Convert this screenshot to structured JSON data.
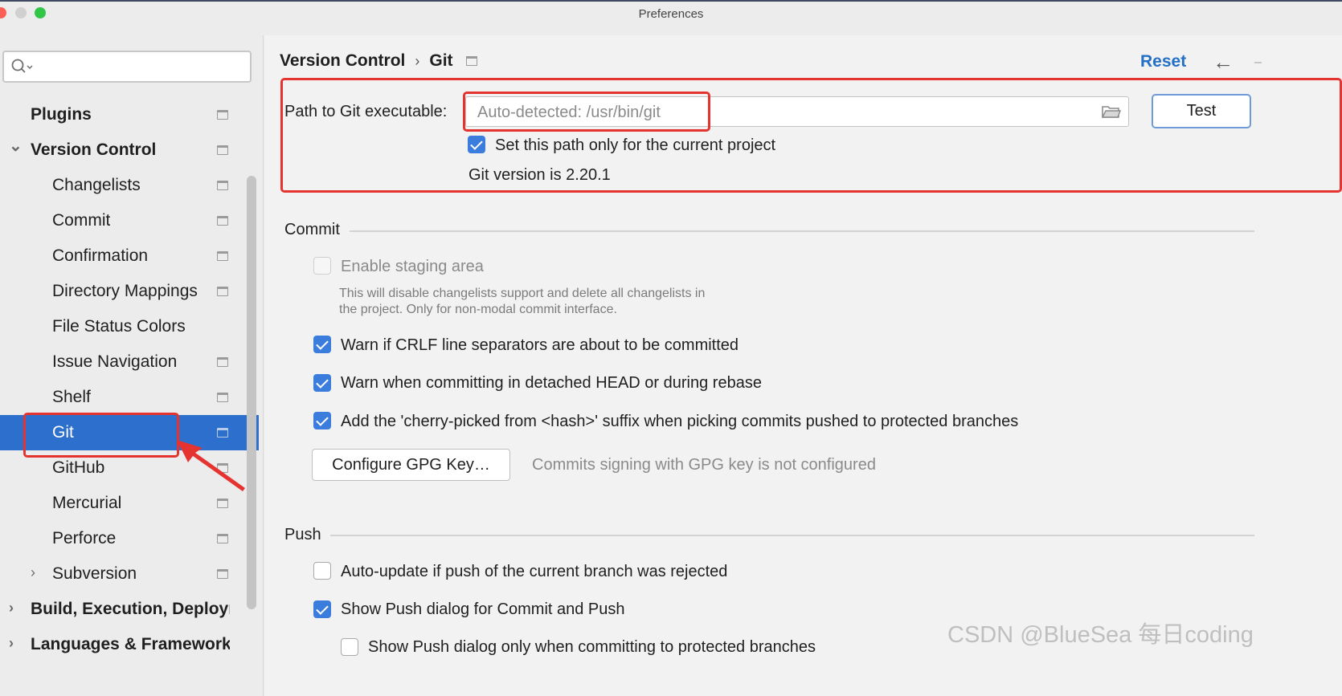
{
  "window": {
    "title": "Preferences"
  },
  "sidebar": {
    "search_placeholder": "",
    "items": [
      {
        "label": "Plugins",
        "bold": true,
        "expander": "",
        "project_icon": true
      },
      {
        "label": "Version Control",
        "bold": true,
        "expander": "⌄",
        "project_icon": true
      },
      {
        "label": "Changelists",
        "bold": false,
        "expander": "",
        "project_icon": true
      },
      {
        "label": "Commit",
        "bold": false,
        "expander": "",
        "project_icon": true
      },
      {
        "label": "Confirmation",
        "bold": false,
        "expander": "",
        "project_icon": true
      },
      {
        "label": "Directory Mappings",
        "bold": false,
        "expander": "",
        "project_icon": true
      },
      {
        "label": "File Status Colors",
        "bold": false,
        "expander": "",
        "project_icon": false
      },
      {
        "label": "Issue Navigation",
        "bold": false,
        "expander": "",
        "project_icon": true
      },
      {
        "label": "Shelf",
        "bold": false,
        "expander": "",
        "project_icon": true
      },
      {
        "label": "Git",
        "bold": false,
        "expander": "",
        "project_icon": true,
        "selected": true
      },
      {
        "label": "GitHub",
        "bold": false,
        "expander": "",
        "project_icon": true
      },
      {
        "label": "Mercurial",
        "bold": false,
        "expander": "",
        "project_icon": true
      },
      {
        "label": "Perforce",
        "bold": false,
        "expander": "",
        "project_icon": true
      },
      {
        "label": "Subversion",
        "bold": false,
        "expander": "›",
        "project_icon": true
      },
      {
        "label": "Build, Execution, Deploym",
        "bold": true,
        "expander": "›",
        "project_icon": false
      },
      {
        "label": "Languages & Frameworks",
        "bold": true,
        "expander": "›",
        "project_icon": false
      }
    ]
  },
  "header": {
    "breadcrumb": [
      "Version Control",
      "Git"
    ],
    "breadcrumb_separator": "›",
    "reset_label": "Reset",
    "back_icon": "←",
    "forward_icon": "→"
  },
  "git_path": {
    "label": "Path to Git executable:",
    "placeholder": "Auto-detected: /usr/bin/git",
    "test_label": "Test",
    "current_project_label": "Set this path only for the current project",
    "current_project_checked": true,
    "version_text": "Git version is 2.20.1"
  },
  "commit_section": {
    "title": "Commit",
    "staging_label": "Enable staging area",
    "staging_checked": false,
    "staging_help": "This will disable changelists support and delete all changelists in the project. Only for non-modal commit interface.",
    "staging_help_line1": "This will disable changelists support and delete all changelists in",
    "staging_help_line2": "the project. Only for non-modal commit interface.",
    "crlf_label": "Warn if CRLF line separators are about to be committed",
    "detached_label": "Warn when committing in detached HEAD or during rebase",
    "cherry_label": "Add the 'cherry-picked from <hash>' suffix when picking commits pushed to protected branches",
    "gpg_button_label": "Configure GPG Key…",
    "gpg_status": "Commits signing with GPG key is not configured"
  },
  "push_section": {
    "title": "Push",
    "auto_update_label": "Auto-update if push of the current branch was rejected",
    "auto_update_checked": false,
    "show_push_label": "Show Push dialog for Commit and Push",
    "show_push_checked": true,
    "protected_only_label": "Show Push dialog only when committing to protected branches",
    "protected_only_checked": false
  },
  "watermark": "CSDN @BlueSea 每日coding",
  "colors": {
    "accent": "#2c6fcd",
    "link": "#2470c4",
    "annotation_red": "#e5332f"
  }
}
